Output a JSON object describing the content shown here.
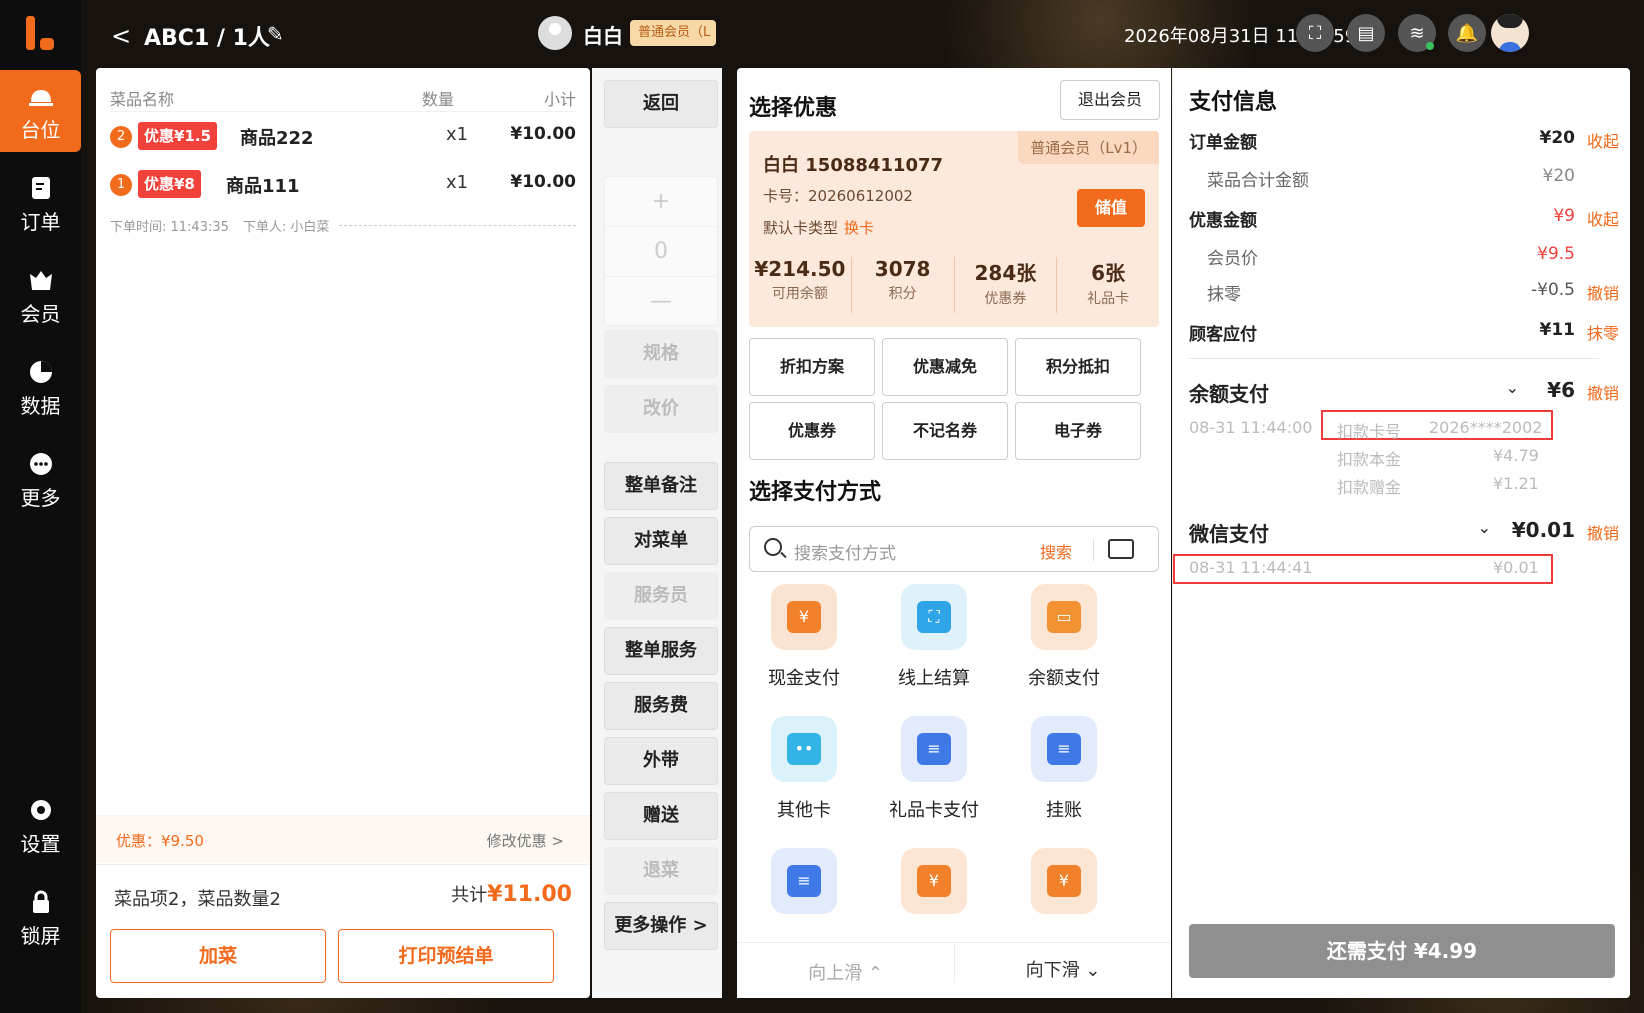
{
  "nav": {
    "items": [
      {
        "label": "台位",
        "icon": "table-bell-icon"
      },
      {
        "label": "订单",
        "icon": "order-icon"
      },
      {
        "label": "会员",
        "icon": "member-icon"
      },
      {
        "label": "数据",
        "icon": "pie-chart-icon"
      },
      {
        "label": "更多",
        "icon": "more-icon"
      },
      {
        "label": "设置",
        "icon": "gear-icon"
      },
      {
        "label": "锁屏",
        "icon": "lock-icon"
      }
    ]
  },
  "header": {
    "back": "<",
    "table_title": "ABC1 / 1人",
    "user_name": "白白",
    "user_level": "普通会员（L",
    "datetime": "2026年08月31日 11:44:59",
    "icons": [
      "scan-icon",
      "printer-icon",
      "wifi-icon",
      "bell-icon"
    ]
  },
  "order": {
    "columns": [
      "菜品名称",
      "数量",
      "小计"
    ],
    "items": [
      {
        "badge": "2",
        "tag": "优惠¥1.5",
        "name": "商品222",
        "qty": "x1",
        "price": "¥10.00"
      },
      {
        "badge": "1",
        "tag": "优惠¥8",
        "name": "商品111",
        "qty": "x1",
        "price": "¥10.00"
      }
    ],
    "meta_time": "下单时间: 11:43:35",
    "meta_user": "下单人: 小白菜",
    "discount": "优惠：¥9.50",
    "modify_discount": "修改优惠 >",
    "summary_left": "菜品项2，菜品数量2",
    "summary_total_label": "共计",
    "summary_total": "¥11.00",
    "add_dish": "加菜",
    "print_pre": "打印预结单"
  },
  "actions": {
    "back": "返回",
    "stepper": [
      "+",
      "0",
      "—"
    ],
    "buttons": [
      {
        "label": "规格",
        "disabled": true
      },
      {
        "label": "改价",
        "disabled": true
      },
      {
        "label": "整单备注",
        "disabled": false
      },
      {
        "label": "对菜单",
        "disabled": false
      },
      {
        "label": "服务员",
        "disabled": true
      },
      {
        "label": "整单服务",
        "disabled": false
      },
      {
        "label": "服务费",
        "disabled": false
      },
      {
        "label": "外带",
        "disabled": false
      },
      {
        "label": "赠送",
        "disabled": false
      },
      {
        "label": "退菜",
        "disabled": true
      },
      {
        "label": "更多操作 >",
        "disabled": false
      }
    ]
  },
  "discounts": {
    "title": "选择优惠",
    "exit_member": "退出会员",
    "member": {
      "name_phone": "白白  15088411077",
      "level": "普通会员（Lv1）",
      "card_no": "卡号：20260612002",
      "card_type": "默认卡类型",
      "switch_card": "换卡",
      "recharge": "储值",
      "stats": [
        {
          "v": "¥214.50",
          "k": "可用余额"
        },
        {
          "v": "3078",
          "k": "积分"
        },
        {
          "v": "284张",
          "k": "优惠券"
        },
        {
          "v": "6张",
          "k": "礼品卡"
        }
      ]
    },
    "buttons": [
      "折扣方案",
      "优惠减免",
      "积分抵扣",
      "优惠券",
      "不记名券",
      "电子券"
    ]
  },
  "payment_methods": {
    "title": "选择支付方式",
    "search_placeholder": "搜索支付方式",
    "search_button": "搜索",
    "items": [
      {
        "label": "现金支付",
        "icon": "cash-icon",
        "color": "#fbe3d2",
        "fg": "#f2812b",
        "glyph": "¥"
      },
      {
        "label": "线上结算",
        "icon": "online-settle-icon",
        "color": "#dff1fb",
        "fg": "#2fa5e8",
        "glyph": "⛶"
      },
      {
        "label": "余额支付",
        "icon": "balance-icon",
        "color": "#fde5d4",
        "fg": "#f39232",
        "glyph": "▭"
      },
      {
        "label": "其他卡",
        "icon": "other-card-icon",
        "color": "#dcf2fb",
        "fg": "#33b4e6",
        "glyph": "••"
      },
      {
        "label": "礼品卡支付",
        "icon": "gift-card-icon",
        "color": "#e1ebfb",
        "fg": "#3f79e6",
        "glyph": "≡"
      },
      {
        "label": "挂账",
        "icon": "credit-icon",
        "color": "#e1ebfb",
        "fg": "#3f79e6",
        "glyph": "≡"
      },
      {
        "label": "",
        "icon": "doc-icon",
        "color": "#e1ebfb",
        "fg": "#3f79e6",
        "glyph": "≡"
      },
      {
        "label": "",
        "icon": "money-bag-icon",
        "color": "#fde5d4",
        "fg": "#f2812b",
        "glyph": "¥"
      },
      {
        "label": "",
        "icon": "money-bag-icon",
        "color": "#fde5d4",
        "fg": "#f2812b",
        "glyph": "¥"
      }
    ],
    "scroll_up": "向上滑 ⌃",
    "scroll_down": "向下滑 ⌄"
  },
  "pay_info": {
    "title": "支付信息",
    "order_amount_label": "订单金额",
    "order_amount": "¥20",
    "collapse": "收起",
    "dish_total_label": "菜品合计金额",
    "dish_total": "¥20",
    "discount_label": "优惠金额",
    "discount_amount": "¥9",
    "member_price_label": "会员价",
    "member_price": "¥9.5",
    "rounding_label": "抹零",
    "rounding": "-¥0.5",
    "cancel": "撤销",
    "due_label": "顾客应付",
    "due": "¥11",
    "due_action": "抹零",
    "balance_pay_label": "余额支付",
    "balance_pay": "¥6",
    "balance_time": "08-31 11:44:00",
    "deduct_card_label": "扣款卡号",
    "deduct_card": "2026****2002",
    "deduct_principal_label": "扣款本金",
    "deduct_principal": "¥4.79",
    "deduct_gift_label": "扣款赠金",
    "deduct_gift": "¥1.21",
    "wechat_pay_label": "微信支付",
    "wechat_pay": "¥0.01",
    "wechat_time": "08-31 11:44:41",
    "wechat_amount": "¥0.01",
    "remaining": "还需支付 ¥4.99"
  }
}
